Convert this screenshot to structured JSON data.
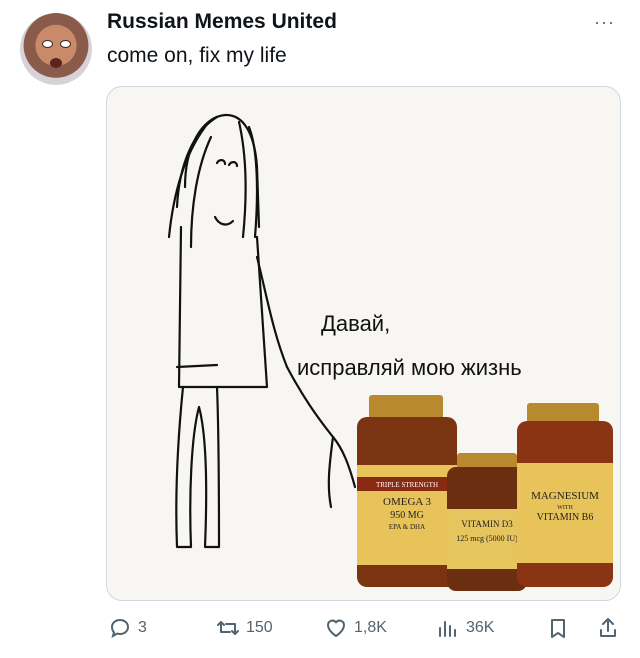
{
  "author": {
    "display_name": "Russian Memes United"
  },
  "tweet": {
    "text": "come on, fix my life"
  },
  "media": {
    "caption_line1": "Давай,",
    "caption_line2": "исправляй мою жизнь",
    "bottles": {
      "omega": {
        "line1": "TRIPLE STRENGTH",
        "line2": "OMEGA 3",
        "line3": "950 MG",
        "line4": "EPA & DHA"
      },
      "vitd": {
        "line1": "VITAMIN D3",
        "line2": "125 mcg (5000 IU)"
      },
      "mag": {
        "line1": "MAGNESIUM",
        "line2": "WITH",
        "line3": "VITAMIN B6"
      }
    }
  },
  "actions": {
    "replies": "3",
    "retweets": "150",
    "likes": "1,8K",
    "views": "36K"
  }
}
